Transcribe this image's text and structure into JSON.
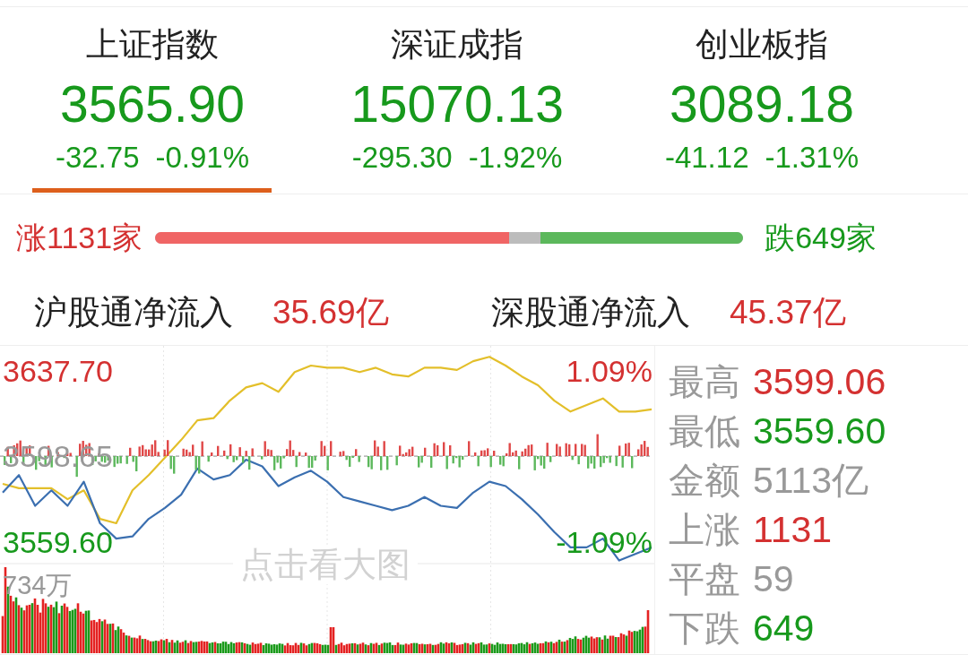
{
  "indices": [
    {
      "name": "上证指数",
      "value": "3565.90",
      "change": "-32.75",
      "percent": "-0.91%",
      "color": "#17991c",
      "selected": true
    },
    {
      "name": "深证成指",
      "value": "15070.13",
      "change": "-295.30",
      "percent": "-1.92%",
      "color": "#17991c",
      "selected": false
    },
    {
      "name": "创业板指",
      "value": "3089.18",
      "change": "-41.12",
      "percent": "-1.31%",
      "color": "#17991c",
      "selected": false
    }
  ],
  "breadth": {
    "up_label": "涨1131家",
    "rise": {
      "level": 0.602
    },
    "fall": {
      "level": 0.345
    },
    "down_label": "跌649家"
  },
  "flows": [
    {
      "label": "沪股通净流入",
      "value": "35.69亿",
      "color": "#d43131"
    },
    {
      "label": "深股通净流入",
      "value": "45.37亿",
      "color": "#d43131"
    }
  ],
  "chart": {
    "chart_data": {
      "type": "line",
      "categories": [
        null,
        null,
        null,
        null,
        null,
        null,
        null,
        null,
        null,
        null,
        null,
        null,
        null,
        null,
        null,
        null,
        null,
        null,
        null,
        null,
        null,
        null,
        null,
        null,
        null,
        null,
        null,
        null,
        null,
        null,
        null,
        null,
        null,
        null,
        null,
        null,
        null,
        null,
        null,
        null,
        null
      ],
      "series": [
        {
          "color": "#e3bf2a",
          "values": [
            3586,
            3584,
            3584,
            3584,
            3579,
            3583,
            3570,
            3568,
            3583,
            3590,
            3598,
            3606,
            3615,
            3616,
            3624,
            3630,
            3632,
            3628,
            3637,
            3640,
            3639,
            3639,
            3637,
            3639,
            3636,
            3635,
            3639,
            3639,
            3638,
            3642,
            3644,
            3640,
            3635,
            3631,
            3624,
            3619,
            3622,
            3625,
            3619,
            3619,
            3620
          ]
        },
        {
          "color": "#3b6fb0",
          "values": [
            3582,
            3590,
            3576,
            3583,
            3576,
            3587,
            3568,
            3561,
            3562,
            3570,
            3575,
            3581,
            3593,
            3588,
            3590,
            3597,
            3594,
            3585,
            3589,
            3592,
            3587,
            3580,
            3578,
            3576,
            3574,
            3576,
            3580,
            3576,
            3575,
            3582,
            3587,
            3585,
            3579,
            3572,
            3564,
            3557,
            3557,
            3561,
            3551,
            3554,
            3557
          ]
        }
      ],
      "ylim": [
        3549.6,
        3649.0
      ],
      "yticks": [
        {
          "value": 3637.7,
          "label": "3637.70"
        },
        {
          "value": 3598.65,
          "label": "3598.65"
        },
        {
          "value": 3559.6,
          "label": "3559.60"
        }
      ],
      "grid": true,
      "ref_lines": [
        {
          "axis": "y",
          "value": 3598.65
        }
      ]
    },
    "pct_high": "1.09%",
    "pct_low": "-1.09%",
    "hint": "点击看大图",
    "volume_max": "734万"
  },
  "stats": [
    {
      "label": "最高",
      "value": "3599.06",
      "color": "#d43131"
    },
    {
      "label": "最低",
      "value": "3559.60",
      "color": "#17991c"
    },
    {
      "label": "金额",
      "value": "5113亿",
      "color": "#999999"
    },
    {
      "label": "上涨",
      "value": "1131",
      "color": "#d43131"
    },
    {
      "label": "平盘",
      "value": "59",
      "color": "#999999"
    },
    {
      "label": "下跌",
      "value": "649",
      "color": "#17991c"
    }
  ]
}
